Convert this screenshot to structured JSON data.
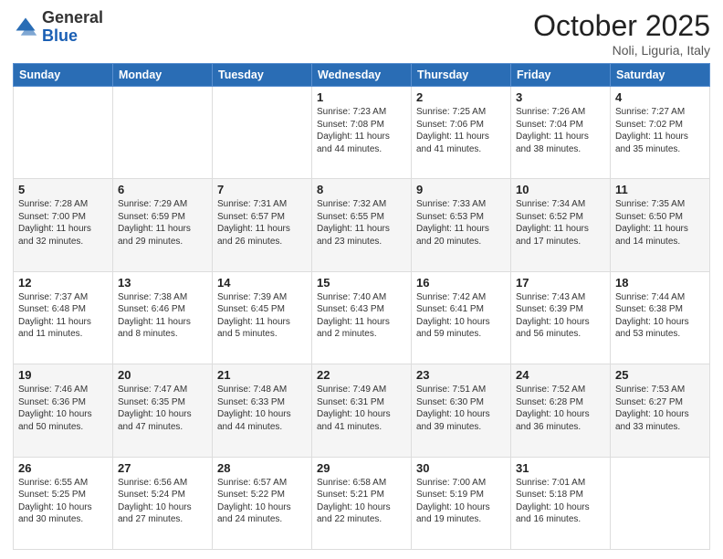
{
  "header": {
    "logo_general": "General",
    "logo_blue": "Blue",
    "month_title": "October 2025",
    "location": "Noli, Liguria, Italy"
  },
  "days_of_week": [
    "Sunday",
    "Monday",
    "Tuesday",
    "Wednesday",
    "Thursday",
    "Friday",
    "Saturday"
  ],
  "weeks": [
    [
      {
        "day": "",
        "info": ""
      },
      {
        "day": "",
        "info": ""
      },
      {
        "day": "",
        "info": ""
      },
      {
        "day": "1",
        "info": "Sunrise: 7:23 AM\nSunset: 7:08 PM\nDaylight: 11 hours\nand 44 minutes."
      },
      {
        "day": "2",
        "info": "Sunrise: 7:25 AM\nSunset: 7:06 PM\nDaylight: 11 hours\nand 41 minutes."
      },
      {
        "day": "3",
        "info": "Sunrise: 7:26 AM\nSunset: 7:04 PM\nDaylight: 11 hours\nand 38 minutes."
      },
      {
        "day": "4",
        "info": "Sunrise: 7:27 AM\nSunset: 7:02 PM\nDaylight: 11 hours\nand 35 minutes."
      }
    ],
    [
      {
        "day": "5",
        "info": "Sunrise: 7:28 AM\nSunset: 7:00 PM\nDaylight: 11 hours\nand 32 minutes."
      },
      {
        "day": "6",
        "info": "Sunrise: 7:29 AM\nSunset: 6:59 PM\nDaylight: 11 hours\nand 29 minutes."
      },
      {
        "day": "7",
        "info": "Sunrise: 7:31 AM\nSunset: 6:57 PM\nDaylight: 11 hours\nand 26 minutes."
      },
      {
        "day": "8",
        "info": "Sunrise: 7:32 AM\nSunset: 6:55 PM\nDaylight: 11 hours\nand 23 minutes."
      },
      {
        "day": "9",
        "info": "Sunrise: 7:33 AM\nSunset: 6:53 PM\nDaylight: 11 hours\nand 20 minutes."
      },
      {
        "day": "10",
        "info": "Sunrise: 7:34 AM\nSunset: 6:52 PM\nDaylight: 11 hours\nand 17 minutes."
      },
      {
        "day": "11",
        "info": "Sunrise: 7:35 AM\nSunset: 6:50 PM\nDaylight: 11 hours\nand 14 minutes."
      }
    ],
    [
      {
        "day": "12",
        "info": "Sunrise: 7:37 AM\nSunset: 6:48 PM\nDaylight: 11 hours\nand 11 minutes."
      },
      {
        "day": "13",
        "info": "Sunrise: 7:38 AM\nSunset: 6:46 PM\nDaylight: 11 hours\nand 8 minutes."
      },
      {
        "day": "14",
        "info": "Sunrise: 7:39 AM\nSunset: 6:45 PM\nDaylight: 11 hours\nand 5 minutes."
      },
      {
        "day": "15",
        "info": "Sunrise: 7:40 AM\nSunset: 6:43 PM\nDaylight: 11 hours\nand 2 minutes."
      },
      {
        "day": "16",
        "info": "Sunrise: 7:42 AM\nSunset: 6:41 PM\nDaylight: 10 hours\nand 59 minutes."
      },
      {
        "day": "17",
        "info": "Sunrise: 7:43 AM\nSunset: 6:39 PM\nDaylight: 10 hours\nand 56 minutes."
      },
      {
        "day": "18",
        "info": "Sunrise: 7:44 AM\nSunset: 6:38 PM\nDaylight: 10 hours\nand 53 minutes."
      }
    ],
    [
      {
        "day": "19",
        "info": "Sunrise: 7:46 AM\nSunset: 6:36 PM\nDaylight: 10 hours\nand 50 minutes."
      },
      {
        "day": "20",
        "info": "Sunrise: 7:47 AM\nSunset: 6:35 PM\nDaylight: 10 hours\nand 47 minutes."
      },
      {
        "day": "21",
        "info": "Sunrise: 7:48 AM\nSunset: 6:33 PM\nDaylight: 10 hours\nand 44 minutes."
      },
      {
        "day": "22",
        "info": "Sunrise: 7:49 AM\nSunset: 6:31 PM\nDaylight: 10 hours\nand 41 minutes."
      },
      {
        "day": "23",
        "info": "Sunrise: 7:51 AM\nSunset: 6:30 PM\nDaylight: 10 hours\nand 39 minutes."
      },
      {
        "day": "24",
        "info": "Sunrise: 7:52 AM\nSunset: 6:28 PM\nDaylight: 10 hours\nand 36 minutes."
      },
      {
        "day": "25",
        "info": "Sunrise: 7:53 AM\nSunset: 6:27 PM\nDaylight: 10 hours\nand 33 minutes."
      }
    ],
    [
      {
        "day": "26",
        "info": "Sunrise: 6:55 AM\nSunset: 5:25 PM\nDaylight: 10 hours\nand 30 minutes."
      },
      {
        "day": "27",
        "info": "Sunrise: 6:56 AM\nSunset: 5:24 PM\nDaylight: 10 hours\nand 27 minutes."
      },
      {
        "day": "28",
        "info": "Sunrise: 6:57 AM\nSunset: 5:22 PM\nDaylight: 10 hours\nand 24 minutes."
      },
      {
        "day": "29",
        "info": "Sunrise: 6:58 AM\nSunset: 5:21 PM\nDaylight: 10 hours\nand 22 minutes."
      },
      {
        "day": "30",
        "info": "Sunrise: 7:00 AM\nSunset: 5:19 PM\nDaylight: 10 hours\nand 19 minutes."
      },
      {
        "day": "31",
        "info": "Sunrise: 7:01 AM\nSunset: 5:18 PM\nDaylight: 10 hours\nand 16 minutes."
      },
      {
        "day": "",
        "info": ""
      }
    ]
  ]
}
